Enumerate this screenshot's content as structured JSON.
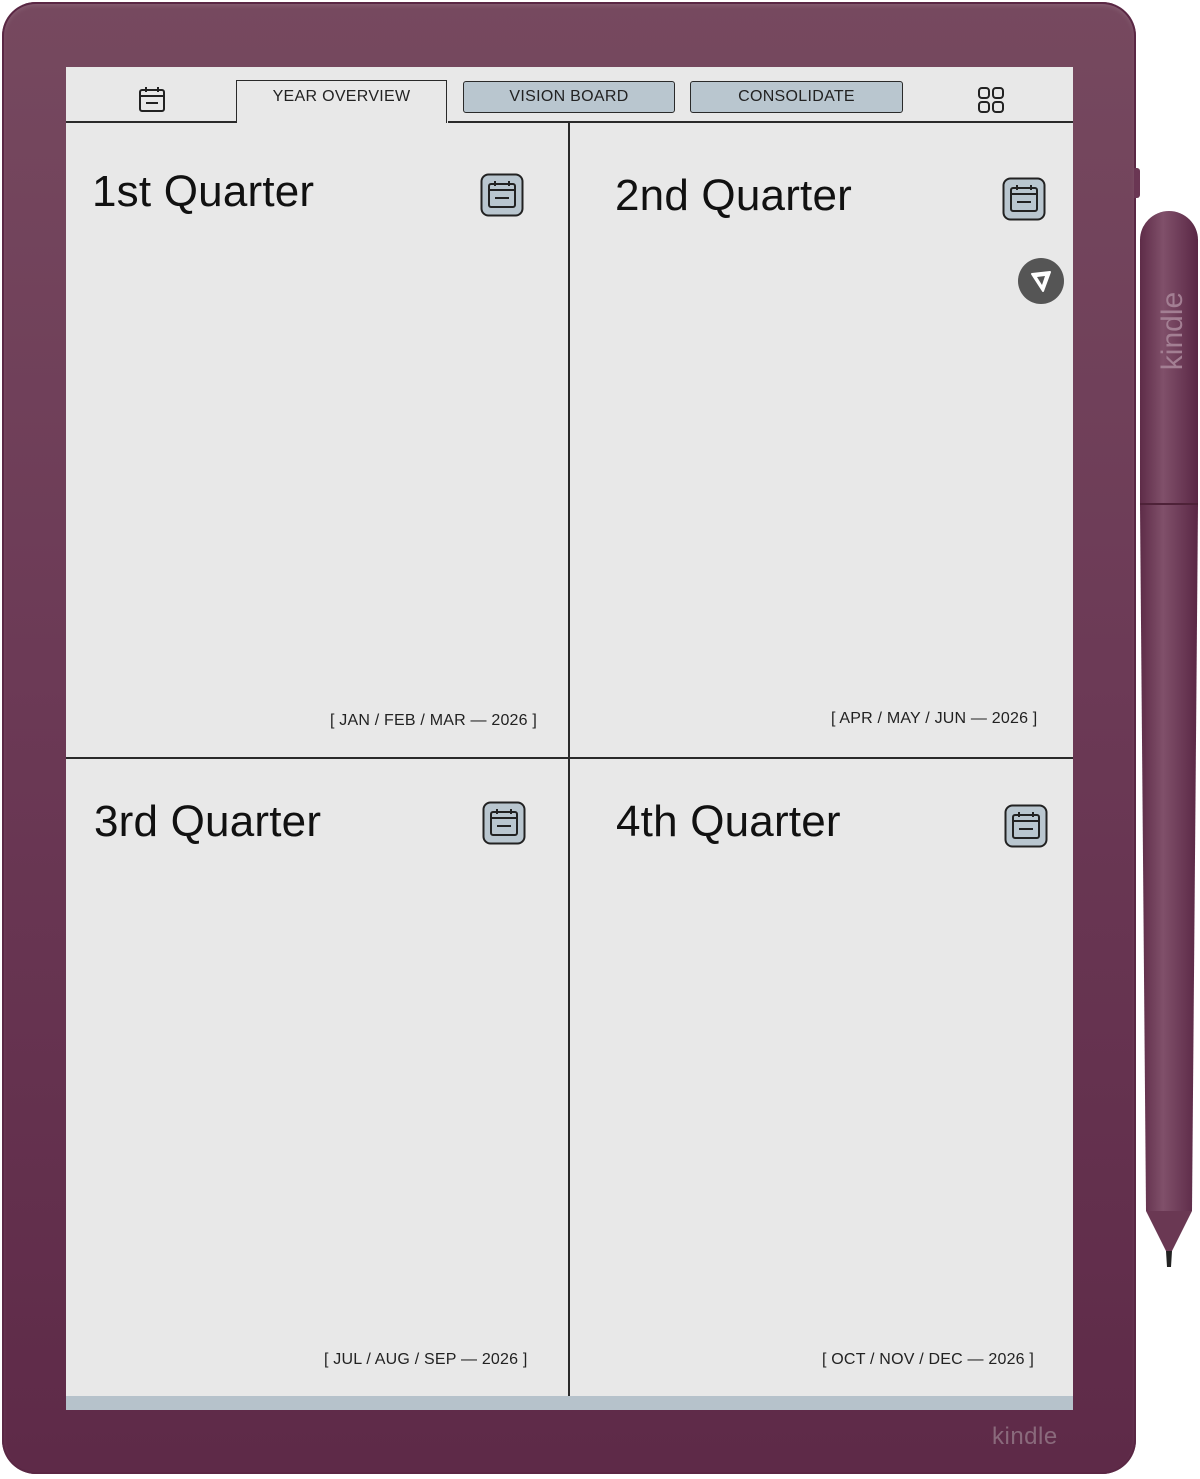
{
  "device": {
    "brand": "kindle",
    "stylus_brand": "kindle",
    "frame_color": "#6c3a56"
  },
  "toolbar": {
    "tabs": [
      {
        "label": "YEAR OVERVIEW",
        "active": true
      },
      {
        "label": "VISION BOARD",
        "active": false
      },
      {
        "label": "CONSOLIDATE",
        "active": false
      }
    ],
    "left_icon": "calendar-icon",
    "right_icon": "grid-menu-icon",
    "button_color": "#b9c6cf"
  },
  "quarters": [
    {
      "title": "1st Quarter",
      "range": "[ JAN / FEB / MAR — 2026 ]",
      "icon": "calendar-icon"
    },
    {
      "title": "2nd Quarter",
      "range": "[ APR / MAY / JUN — 2026 ]",
      "icon": "calendar-icon"
    },
    {
      "title": "3rd Quarter",
      "range": "[ JUL / AUG / SEP — 2026 ]",
      "icon": "calendar-icon"
    },
    {
      "title": "4th Quarter",
      "range": "[ OCT / NOV / DEC — 2026 ]",
      "icon": "calendar-icon"
    }
  ],
  "floating_button": {
    "icon": "pen-tool-icon"
  }
}
